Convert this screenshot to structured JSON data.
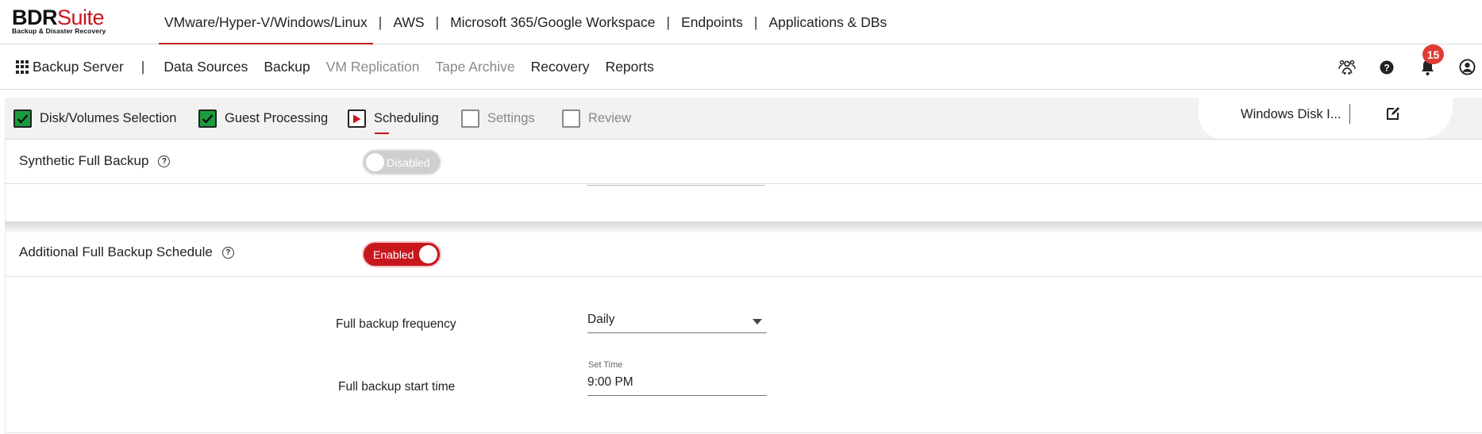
{
  "logo": {
    "brand_bold": "BDR",
    "brand_rest": "Suite",
    "tagline": "Backup & Disaster Recovery"
  },
  "top_nav": {
    "items": [
      "VMware/Hyper-V/Windows/Linux",
      "AWS",
      "Microsoft 365/Google Workspace",
      "Endpoints",
      "Applications & DBs"
    ],
    "separator": "|",
    "active_index": 0
  },
  "secondary_nav": {
    "server_label": "Backup Server",
    "separator": "|",
    "items": [
      {
        "label": "Data Sources",
        "enabled": true
      },
      {
        "label": "Backup",
        "enabled": true
      },
      {
        "label": "VM Replication",
        "enabled": false
      },
      {
        "label": "Tape Archive",
        "enabled": false
      },
      {
        "label": "Recovery",
        "enabled": true
      },
      {
        "label": "Reports",
        "enabled": true
      }
    ],
    "icons": [
      "users-group-icon",
      "help-icon",
      "bell-icon",
      "user-icon"
    ],
    "notification_count": "15"
  },
  "wizard": {
    "steps": [
      {
        "label": "Disk/Volumes Selection",
        "state": "done"
      },
      {
        "label": "Guest Processing",
        "state": "done"
      },
      {
        "label": "Scheduling",
        "state": "current"
      },
      {
        "label": "Settings",
        "state": "pending"
      },
      {
        "label": "Review",
        "state": "pending"
      }
    ],
    "job_name": "Windows Disk I...",
    "edit_icon": "edit-icon"
  },
  "scheduling": {
    "synthetic_full": {
      "label": "Synthetic Full Backup",
      "toggle_text": "Disabled",
      "enabled": false
    },
    "additional_full": {
      "label": "Additional Full Backup Schedule",
      "toggle_text": "Enabled",
      "enabled": true
    },
    "frequency": {
      "label": "Full backup frequency",
      "value": "Daily"
    },
    "start_time": {
      "label": "Full backup start time",
      "caption": "Set Time",
      "value": "9:00 PM"
    }
  },
  "colors": {
    "accent": "#c8161d",
    "done_green": "#1a9c3e",
    "badge": "#e03b35"
  }
}
